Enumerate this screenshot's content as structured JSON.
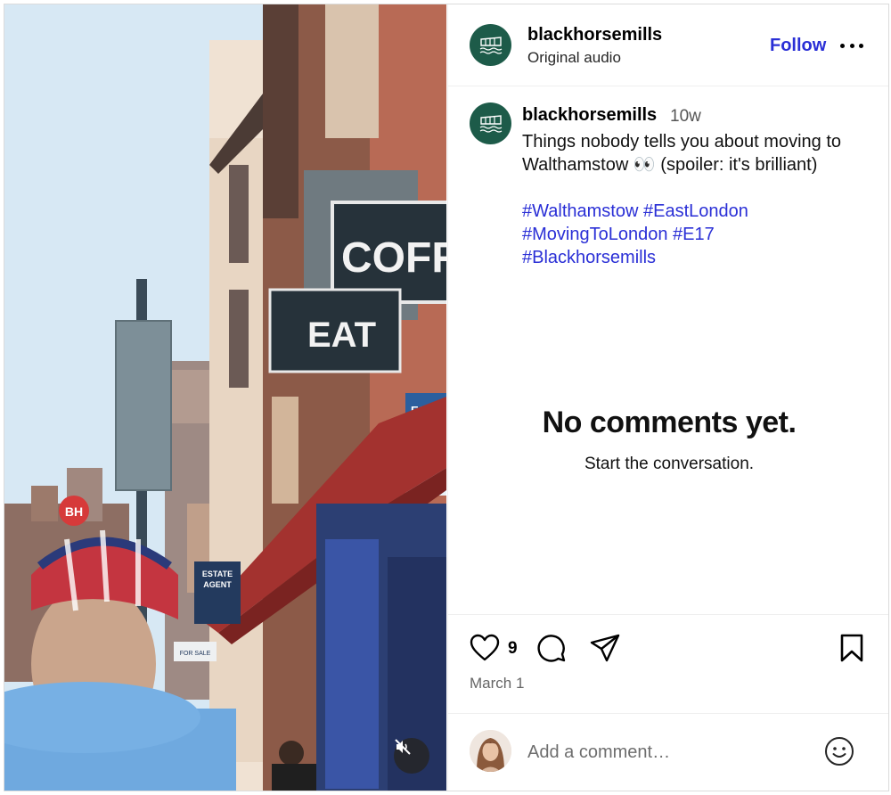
{
  "post": {
    "username": "blackhorsemills",
    "audio": "Original audio",
    "follow_label": "Follow",
    "caption": {
      "username": "blackhorsemills",
      "age": "10w",
      "text": "Things nobody tells you about moving to Walthamstow 👀 (spoiler: it's brilliant)",
      "hashtags": [
        "#Walthamstow",
        "#EastLondon",
        "#MovingToLondon",
        "#E17",
        "#Blackhorsemills"
      ]
    },
    "empty_state": {
      "title": "No comments yet.",
      "subtitle": "Start the conversation."
    },
    "likes": "9",
    "date": "March 1",
    "comment_placeholder": "Add a comment…"
  },
  "media": {
    "signs": {
      "coffee": "COFFE",
      "eat": "EAT",
      "bh": "BH",
      "estate": "ESTATE",
      "agent": "AGENT",
      "for_sale": "FOR SALE",
      "eco": "ECO"
    }
  },
  "colors": {
    "brand_green": "#1d5b49",
    "link_blue": "#2a2fd6"
  },
  "icons": {
    "mute": "speaker-muted-icon",
    "like": "heart-icon",
    "comment": "comment-bubble-icon",
    "share": "paper-plane-icon",
    "save": "bookmark-icon",
    "emoji": "smiley-icon",
    "more": "more-horizontal-icon"
  }
}
